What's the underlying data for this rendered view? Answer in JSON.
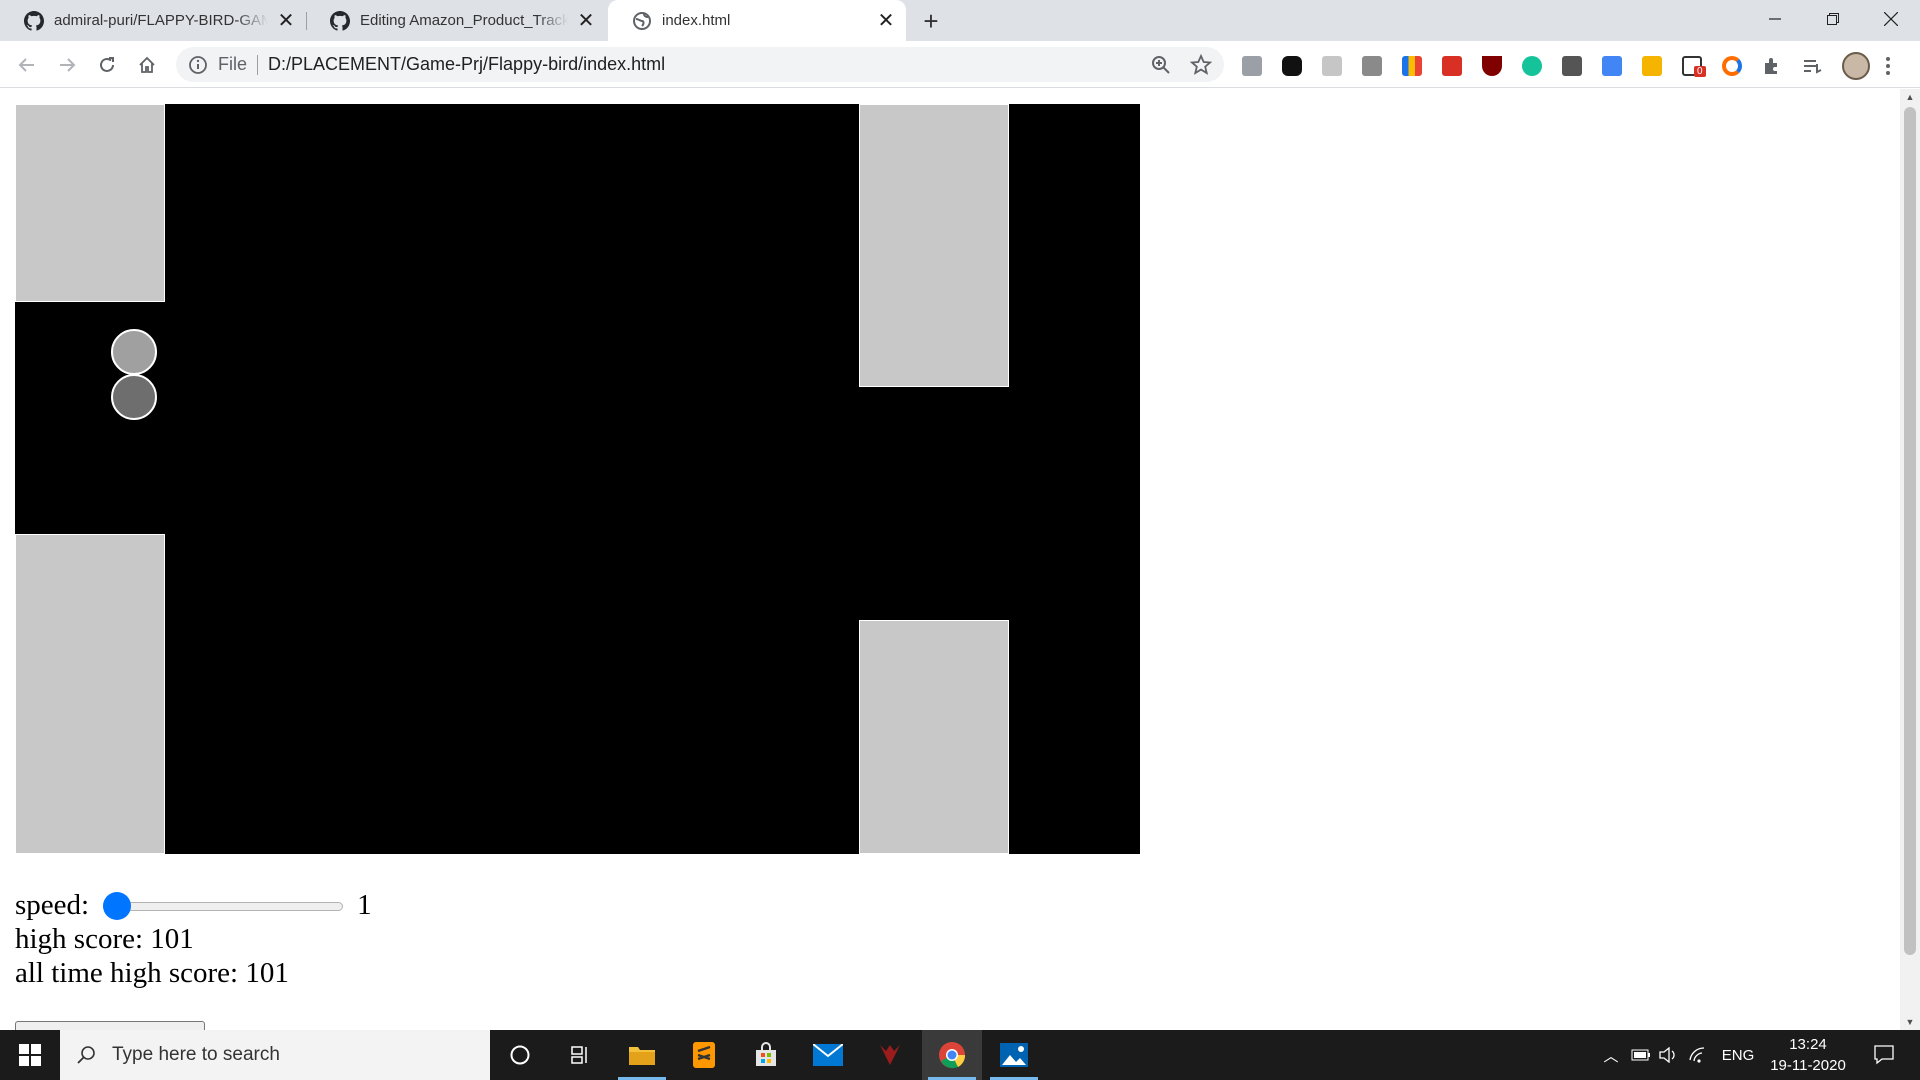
{
  "browser": {
    "tabs": [
      {
        "title": "admiral-puri/FLAPPY-BIRD-GAME",
        "icon": "github-icon",
        "active": false
      },
      {
        "title": "Editing Amazon_Product_Tracker/",
        "icon": "github-icon",
        "active": false
      },
      {
        "title": "index.html",
        "icon": "globe-icon",
        "active": true
      }
    ],
    "new_tab_label": "+",
    "omnibox": {
      "scheme_label": "File",
      "url": "D:/PLACEMENT/Game-Prj/Flappy-bird/index.html"
    },
    "extension_badge": "0"
  },
  "game": {
    "speed_label": "speed:",
    "speed_value": "1",
    "speed_slider": {
      "min": 1,
      "max": 10,
      "value": 1
    },
    "high_score_text": "high score: 101",
    "all_time_high_score_text": "all time high score: 101",
    "colors": {
      "background": "#000000",
      "pipe": "#c8c8c8",
      "bird_top": "#a0a0a0",
      "bird_bottom": "#6e6e6e"
    }
  },
  "taskbar": {
    "search_placeholder": "Type here to search",
    "apps": [
      "cortana-icon",
      "task-view-icon",
      "file-explorer-icon",
      "sublime-text-icon",
      "store-icon",
      "mail-icon",
      "predator-icon",
      "chrome-icon",
      "photos-icon"
    ],
    "language": "ENG",
    "time": "13:24",
    "date": "19-11-2020"
  }
}
